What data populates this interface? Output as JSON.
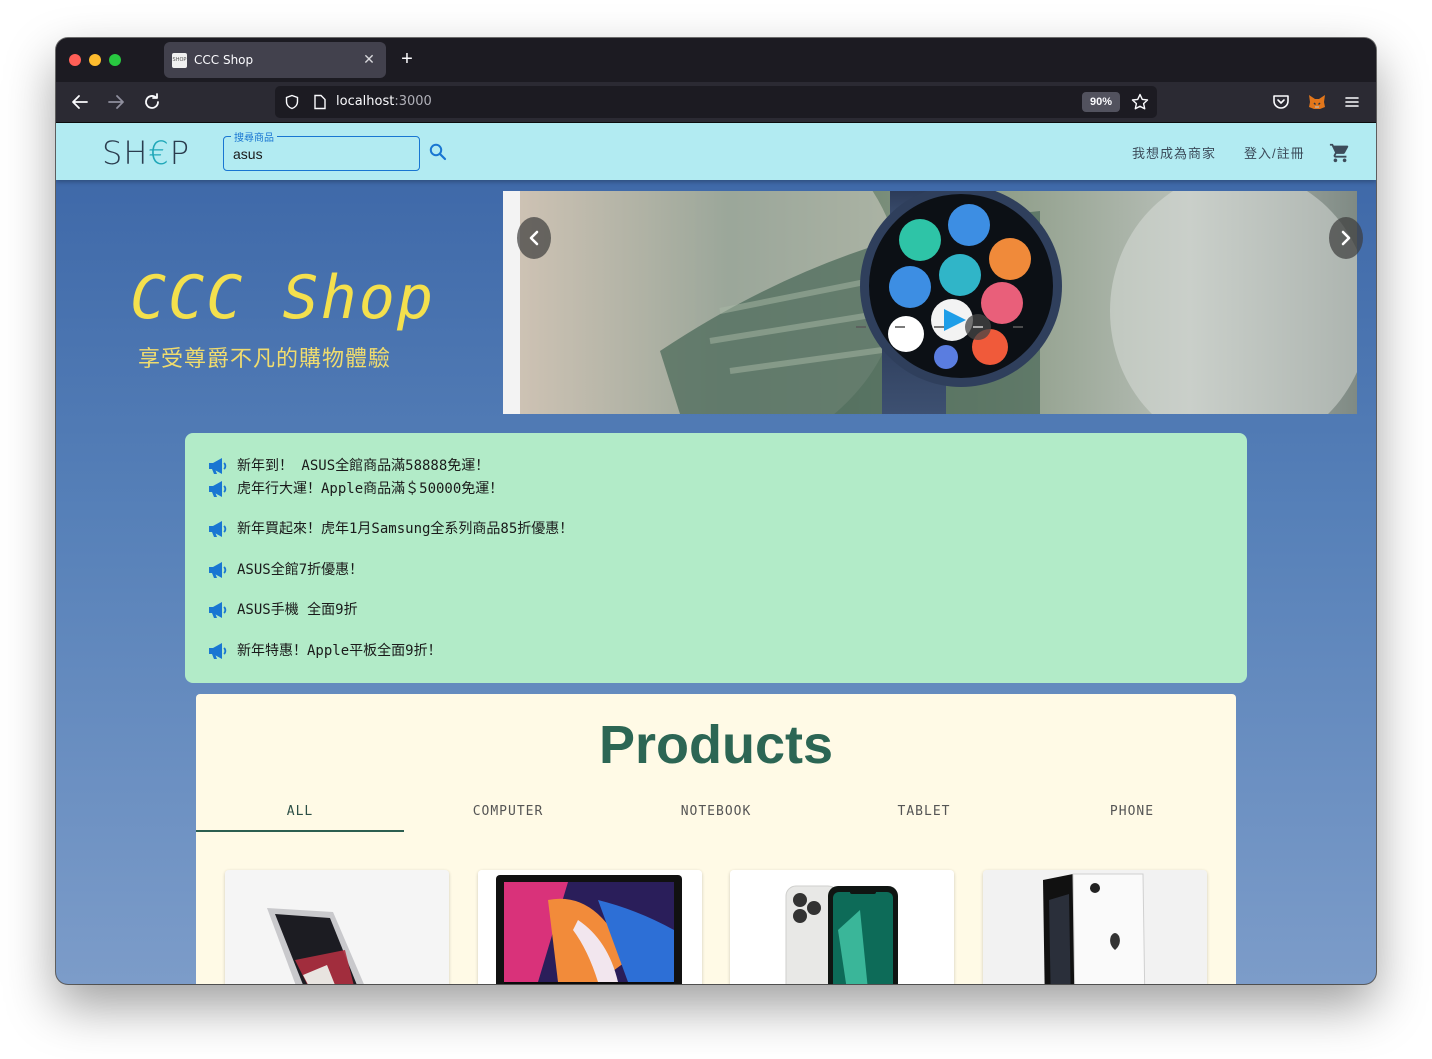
{
  "browser": {
    "tab_title": "CCC Shop",
    "tab_favicon_text": "SHOP",
    "url_host": "localhost",
    "url_port": ":3000",
    "zoom": "90%"
  },
  "header": {
    "logo_prefix": "SH",
    "logo_accent": "€",
    "logo_suffix": "P",
    "search_label": "搜尋商品",
    "search_value": "asus",
    "merchant_link": "我想成為商家",
    "login_link": "登入/註冊"
  },
  "hero": {
    "title": "CCC Shop",
    "subtitle": "享受尊爵不凡的購物體驗",
    "carousel_slide_count": 5,
    "carousel_active_index": 3
  },
  "announcements": [
    "新年到！ ASUS全館商品滿58888免運！",
    "虎年行大運！Apple商品滿＄50000免運！",
    "新年買起來！虎年1月Samsung全系列商品85折優惠！",
    "ASUS全館7折優惠！",
    "ASUS手機  全面9折",
    "新年特惠！Apple平板全面9折！"
  ],
  "products": {
    "title": "Products",
    "tabs": [
      "ALL",
      "COMPUTER",
      "NOTEBOOK",
      "TABLET",
      "PHONE"
    ],
    "active_tab": "ALL",
    "cards": [
      "notebook",
      "desktop-computer",
      "phone",
      "phone"
    ]
  },
  "colors": {
    "appbar": "#b2ebf2",
    "hero_title": "#f4e04d",
    "notice_bg": "#b2ebc8",
    "products_bg": "#fffae6",
    "products_title": "#2c6654",
    "accent_blue": "#1976d2"
  }
}
